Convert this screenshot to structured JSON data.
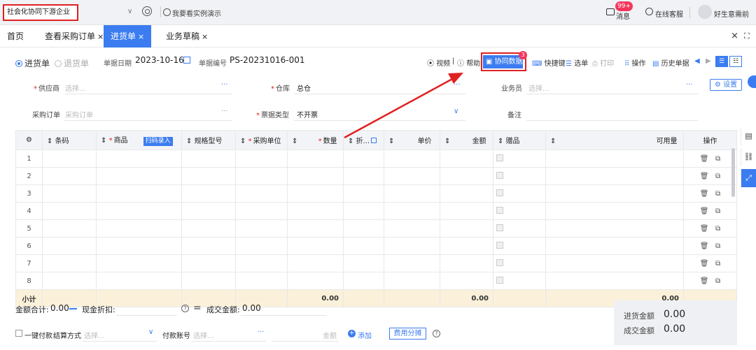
{
  "topbar": {
    "company": "社会化协同下游企业",
    "demo_link": "我要看实例演示",
    "messages_label": "消息",
    "messages_badge": "99+",
    "service_label": "在线客服",
    "username": "好生意需前"
  },
  "tabs": [
    {
      "label": "首页"
    },
    {
      "label": "查看采购订单",
      "close": "×"
    },
    {
      "label": "进货单",
      "close": "×",
      "active": true
    },
    {
      "label": "业务草稿",
      "close": "×"
    }
  ],
  "tabbar_right": {
    "close": "×",
    "fullscreen": "⛶"
  },
  "doc": {
    "radio_purchase": "进货单",
    "radio_return": "退货单",
    "date_label": "单据日期",
    "date_value": "2023-10-16",
    "no_label": "单据编号",
    "no_value": "PS-20231016-001"
  },
  "toolbar": {
    "video": "视频",
    "help": "帮助",
    "collab": "协同数据",
    "collab_badge": "3",
    "shortcut": "快捷键",
    "select": "选单",
    "print": "打印",
    "ops": "操作",
    "history": "历史单据",
    "prev": "◀",
    "next": "▶"
  },
  "fields": {
    "supplier_label": "供应商",
    "supplier_ph": "选择...",
    "warehouse_label": "仓库",
    "warehouse_value": "总仓",
    "salesman_label": "业务员",
    "salesman_ph": "选择...",
    "settings_btn": "设置",
    "po_label": "采购订单",
    "po_ph": "采购订单",
    "invoice_label": "票据类型",
    "invoice_value": "不开票",
    "remark_label": "备注",
    "more": "···"
  },
  "table": {
    "headers": {
      "barcode": "条码",
      "goods": "商品",
      "scan": "扫码录入",
      "spec": "规格型号",
      "unit": "采购单位",
      "qty": "数量",
      "discount": "折...",
      "price": "单价",
      "amount": "金额",
      "gift": "赠品",
      "available": "可用量",
      "ops": "操作"
    },
    "rows": [
      "1",
      "2",
      "3",
      "4",
      "5",
      "6",
      "7",
      "8"
    ],
    "subtotal": {
      "label": "小计",
      "qty": "0.00",
      "amount": "0.00",
      "available": "0.00"
    }
  },
  "summary": {
    "total_label": "金额合计:",
    "total_value": "0.00",
    "cash_discount_label": "现金折扣:",
    "deal_label": "成交金额:",
    "deal_value": "0.00"
  },
  "bottom": {
    "onekey_pay": "一键付款",
    "settle_label": "结算方式",
    "settle_ph": "选择...",
    "account_label": "付款账号",
    "account_ph": "选择...",
    "amount_ph": "金额",
    "add_label": "添加",
    "fee_btn": "费用分摊"
  },
  "totals": {
    "purchase_label": "进货金额",
    "purchase_value": "0.00",
    "deal_label": "成交金额",
    "deal_value": "0.00"
  },
  "colors": {
    "accent": "#3b7cf0",
    "highlight": "#e02020",
    "subtotal_bg": "#fbf1db"
  }
}
